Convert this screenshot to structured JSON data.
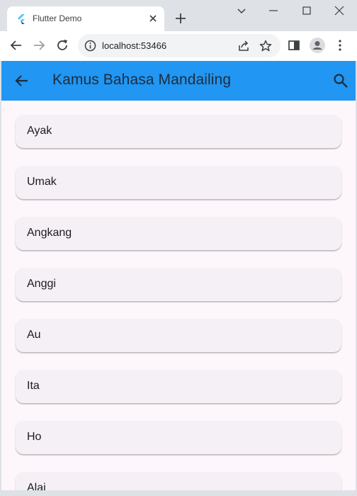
{
  "browser": {
    "tab_title": "Flutter Demo",
    "url": "localhost:53466"
  },
  "app": {
    "title": "Kamus Bahasa Mandailing",
    "appbar_color": "#2196f3",
    "items": [
      {
        "label": "Ayak"
      },
      {
        "label": "Umak"
      },
      {
        "label": "Angkang"
      },
      {
        "label": "Anggi"
      },
      {
        "label": "Au"
      },
      {
        "label": "Ita"
      },
      {
        "label": "Ho"
      },
      {
        "label": "Alai"
      }
    ]
  }
}
